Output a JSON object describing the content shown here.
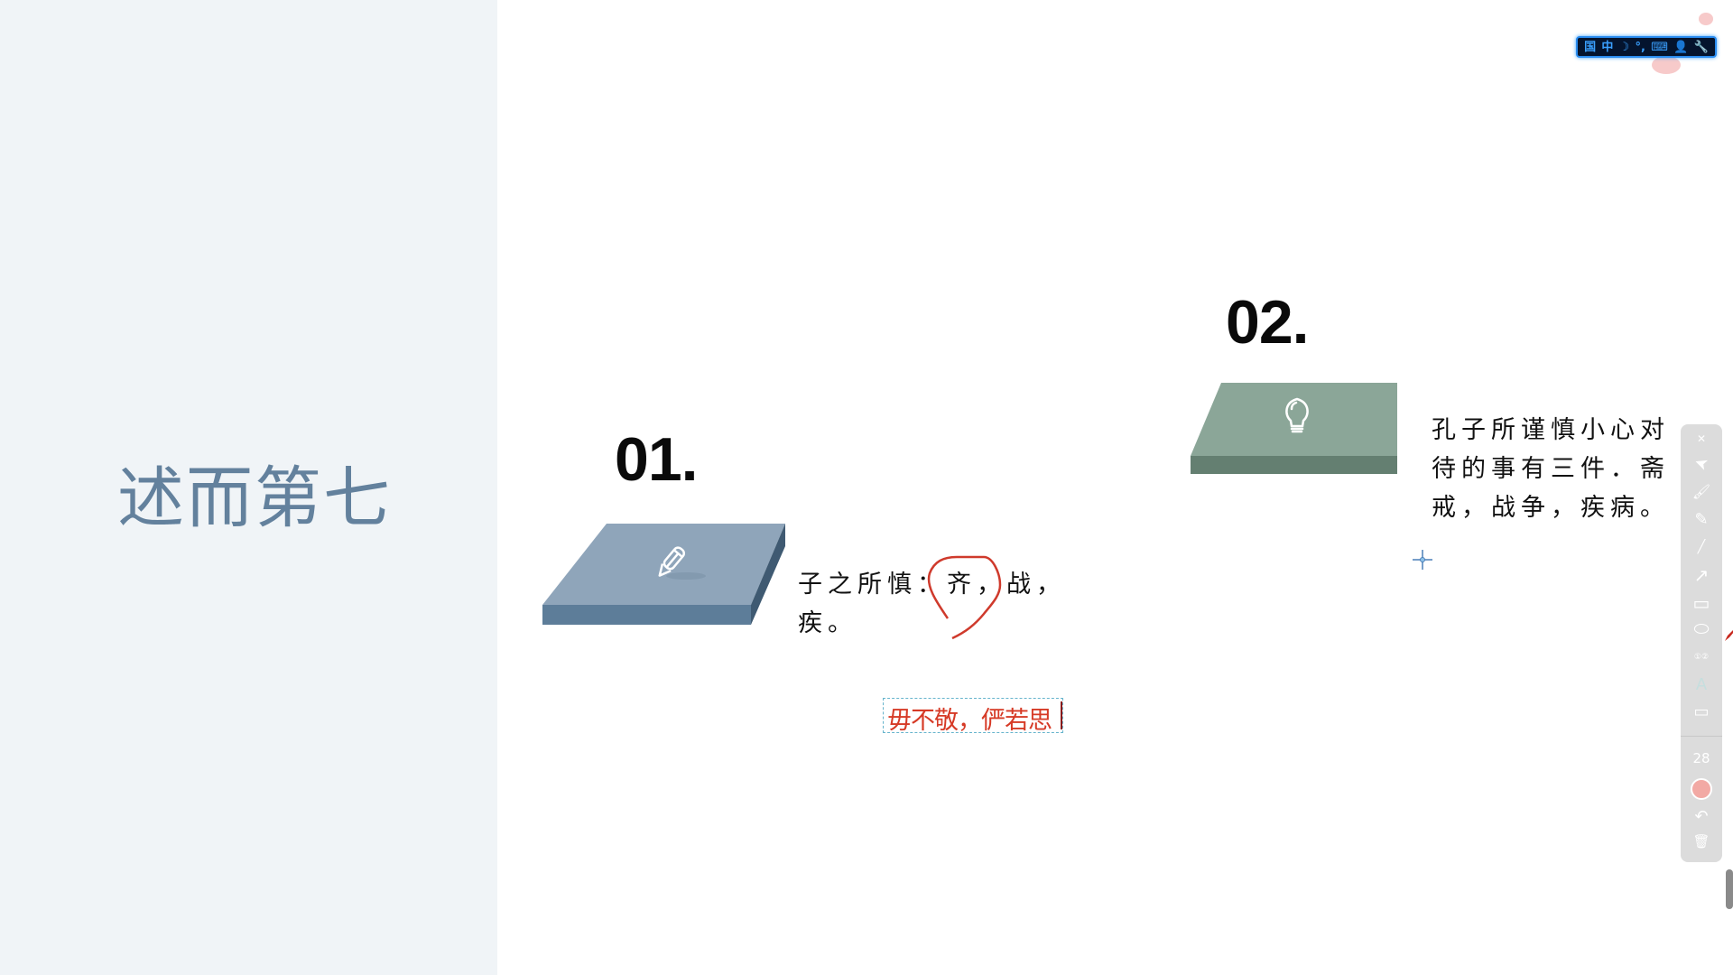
{
  "slide": {
    "section_title": "述而第七",
    "steps": [
      {
        "number": "01.",
        "icon": "pencil-icon",
        "text": "子之所慎：齐，战，疾。",
        "slab_top_color": "#8fa5ba",
        "slab_front_color": "#5d7d99",
        "slab_side_color": "#3f5a72"
      },
      {
        "number": "02.",
        "icon": "lightbulb-icon",
        "text": "孔子所谨慎小心对待的事有三件．斋戒，战争，疾病。",
        "slab_top_color": "#8ba698",
        "slab_front_color": "#647f71"
      }
    ],
    "annotation_text": "毋不敬，俨若思",
    "annotation_color": "#d63a26"
  },
  "ime_bar": {
    "items": [
      "国",
      "中",
      "☽",
      "°,",
      "⌨",
      "👤",
      "🔧"
    ]
  },
  "annotation_toolbar": {
    "tools": [
      {
        "name": "close",
        "glyph": "✕"
      },
      {
        "name": "select",
        "glyph": "➤"
      },
      {
        "name": "brush",
        "glyph": "🖌"
      },
      {
        "name": "highlighter",
        "glyph": "✎"
      },
      {
        "name": "line",
        "glyph": "╱"
      },
      {
        "name": "arrow",
        "glyph": "↗"
      },
      {
        "name": "rectangle",
        "glyph": "▭"
      },
      {
        "name": "ellipse",
        "glyph": "⬭"
      },
      {
        "name": "numbering",
        "glyph": "①②"
      },
      {
        "name": "text",
        "glyph": "A"
      },
      {
        "name": "whiteboard",
        "glyph": "▭"
      }
    ],
    "pen_size": "28",
    "pen_color": "#f2a9a4",
    "undo_glyph": "↶",
    "delete_glyph": "🗑"
  }
}
